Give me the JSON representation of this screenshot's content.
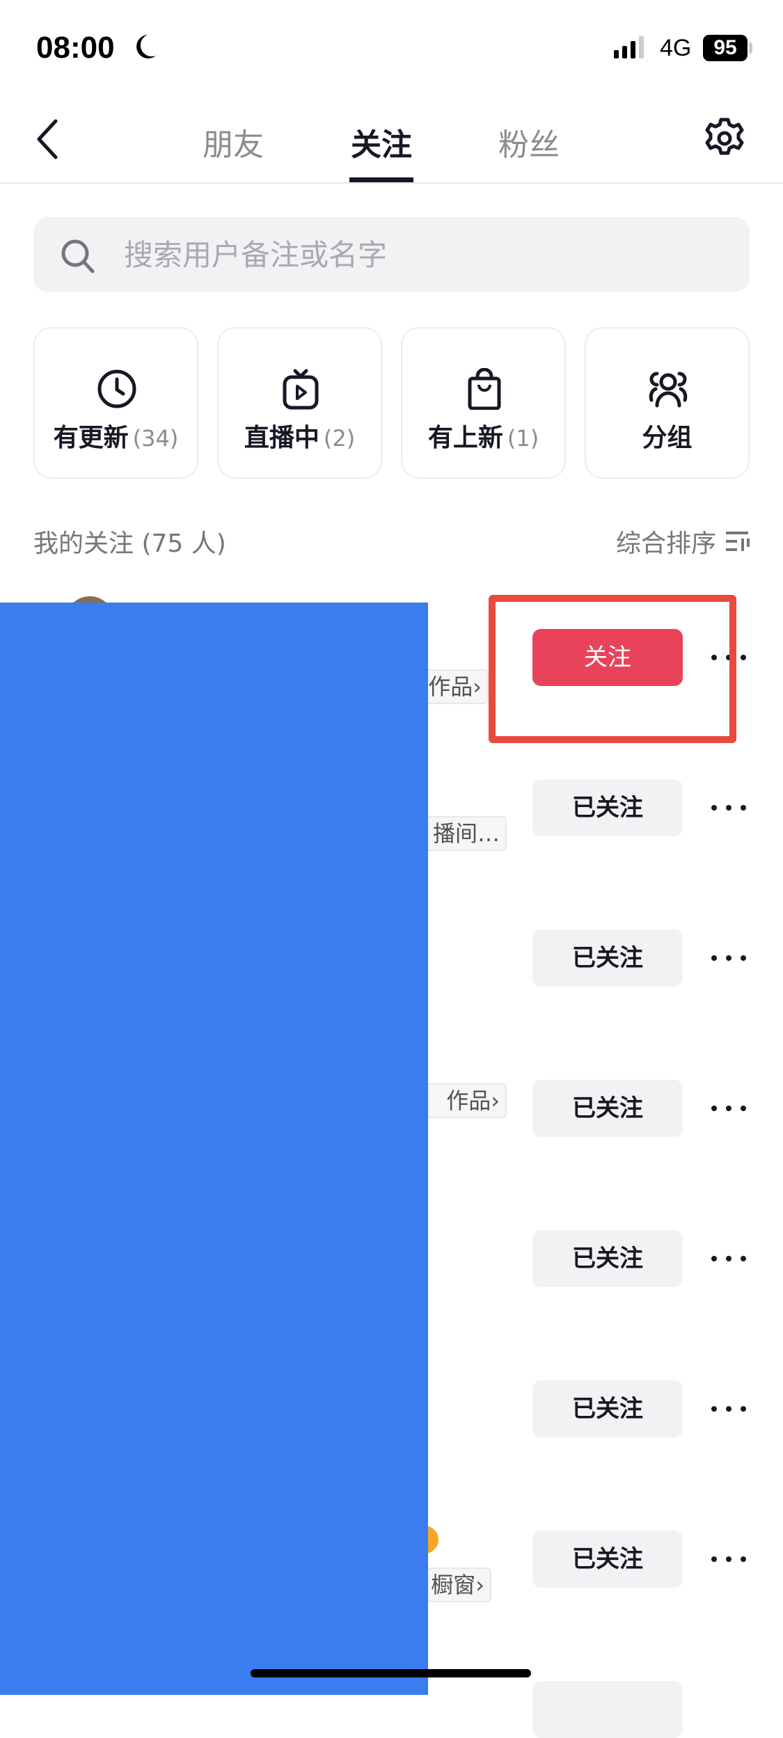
{
  "status_bar": {
    "time": "08:00",
    "network": "4G",
    "battery": "95",
    "icons": [
      "moon-icon",
      "signal-icon",
      "battery-icon"
    ]
  },
  "nav": {
    "tabs": [
      {
        "label": "朋友"
      },
      {
        "label": "关注",
        "active": true
      },
      {
        "label": "粉丝"
      }
    ],
    "icons": [
      "back-icon",
      "gear-icon"
    ]
  },
  "search": {
    "placeholder": "搜索用户备注或名字",
    "value": ""
  },
  "filters": [
    {
      "label": "有更新",
      "count": "(34)",
      "icon": "clock-icon"
    },
    {
      "label": "直播中",
      "count": "(2)",
      "icon": "tv-icon"
    },
    {
      "label": "有上新",
      "count": "(1)",
      "icon": "shopping-bag-icon"
    },
    {
      "label": "分组",
      "count": "",
      "icon": "group-icon"
    }
  ],
  "list": {
    "title": "我的关注 (75 人)",
    "sort_label": "综合排序",
    "rows": [
      {
        "tag": "作品›",
        "button": "关注",
        "following": false
      },
      {
        "tag": "播间…",
        "button": "已关注",
        "following": true
      },
      {
        "tag": "",
        "button": "已关注",
        "following": true
      },
      {
        "tag": "作品›",
        "button": "已关注",
        "following": true
      },
      {
        "tag": "",
        "button": "已关注",
        "following": true
      },
      {
        "tag": "",
        "button": "已关注",
        "following": true
      },
      {
        "tag": "橱窗›",
        "button": "已关注",
        "following": true
      }
    ]
  },
  "colors": {
    "follow": "#e9435b",
    "redaction": "#3b7cef",
    "highlight": "#e84a3d"
  }
}
